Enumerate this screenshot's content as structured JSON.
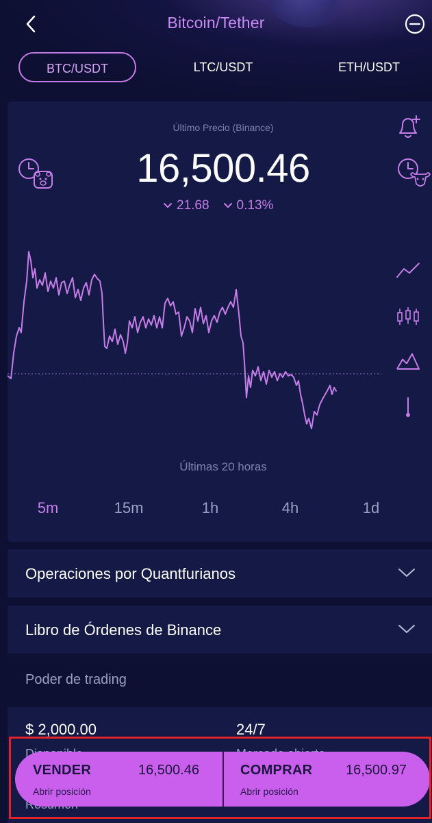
{
  "header": {
    "title": "Bitcoin/Tether",
    "back_icon": "chevron-left-icon",
    "action_icon": "minus-circle-icon"
  },
  "pairs": [
    {
      "label": "BTC/USDT",
      "active": true
    },
    {
      "label": "LTC/USDT",
      "active": false
    },
    {
      "label": "ETH/USDT",
      "active": false
    }
  ],
  "price": {
    "label": "Último Precio (Binance)",
    "value": "16,500.46",
    "change_abs": "21.68",
    "change_pct": "0.13%",
    "direction": "down"
  },
  "chart": {
    "period_label": "Últimas 20 horas",
    "line_color": "#c77de9",
    "timeframes": [
      {
        "label": "5m",
        "active": true
      },
      {
        "label": "15m",
        "active": false
      },
      {
        "label": "1h",
        "active": false
      },
      {
        "label": "4h",
        "active": false
      },
      {
        "label": "1d",
        "active": false
      }
    ],
    "tools": [
      "line-chart-icon",
      "candlestick-icon",
      "area-chart-icon",
      "indicator-icon"
    ],
    "left_icon": "clock-bear-icon",
    "right_icons": [
      "bell-plus-icon",
      "clock-bull-icon"
    ]
  },
  "sections": [
    {
      "title": "Operaciones por Quantfurianos"
    },
    {
      "title": "Libro de Órdenes de Binance"
    }
  ],
  "trading": {
    "label": "Poder de trading",
    "stats": [
      {
        "value": "$ 2,000.00",
        "caption": "Disponible"
      },
      {
        "value": "24/7",
        "caption": "Mercado abierto"
      }
    ],
    "summary_label": "Resumen"
  },
  "actions": {
    "sell": {
      "label": "VENDER",
      "price": "16,500.46",
      "sub": "Abrir posición"
    },
    "buy": {
      "label": "COMPRAR",
      "price": "16,500.97",
      "sub": "Abrir posición"
    }
  },
  "colors": {
    "background": "#0d1033",
    "card": "#141a45",
    "accent": "#c77de9",
    "highlight_frame": "#e0222a"
  }
}
